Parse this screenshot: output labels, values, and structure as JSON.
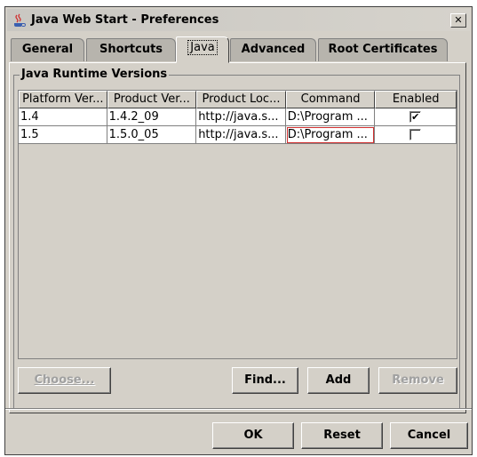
{
  "window": {
    "title": "Java Web Start - Preferences",
    "close_glyph": "✕"
  },
  "tabs": [
    {
      "label": "General",
      "selected": false
    },
    {
      "label": "Shortcuts",
      "selected": false
    },
    {
      "label": "Java",
      "selected": true
    },
    {
      "label": "Advanced",
      "selected": false
    },
    {
      "label": "Root Certificates",
      "selected": false
    }
  ],
  "group": {
    "title": "Java Runtime Versions"
  },
  "table": {
    "columns": [
      "Platform Ver...",
      "Product Ver...",
      "Product Loc...",
      "Command",
      "Enabled"
    ],
    "rows": [
      {
        "platform": "1.4",
        "product": "1.4.2_09",
        "location": "http://java.s...",
        "command": "D:\\Program ...",
        "enabled": true,
        "enabled_glyph": "✔"
      },
      {
        "platform": "1.5",
        "product": "1.5.0_05",
        "location": "http://java.s...",
        "command": "D:\\Program ...",
        "enabled": false,
        "enabled_glyph": ""
      }
    ]
  },
  "panel_buttons": {
    "choose": "Choose...",
    "find": "Find...",
    "add": "Add",
    "remove": "Remove"
  },
  "dialog_buttons": {
    "ok": "OK",
    "reset": "Reset",
    "cancel": "Cancel"
  },
  "icons": {
    "title_icon": "java-cup-icon",
    "checkbox_checked": "checkmark-icon"
  }
}
